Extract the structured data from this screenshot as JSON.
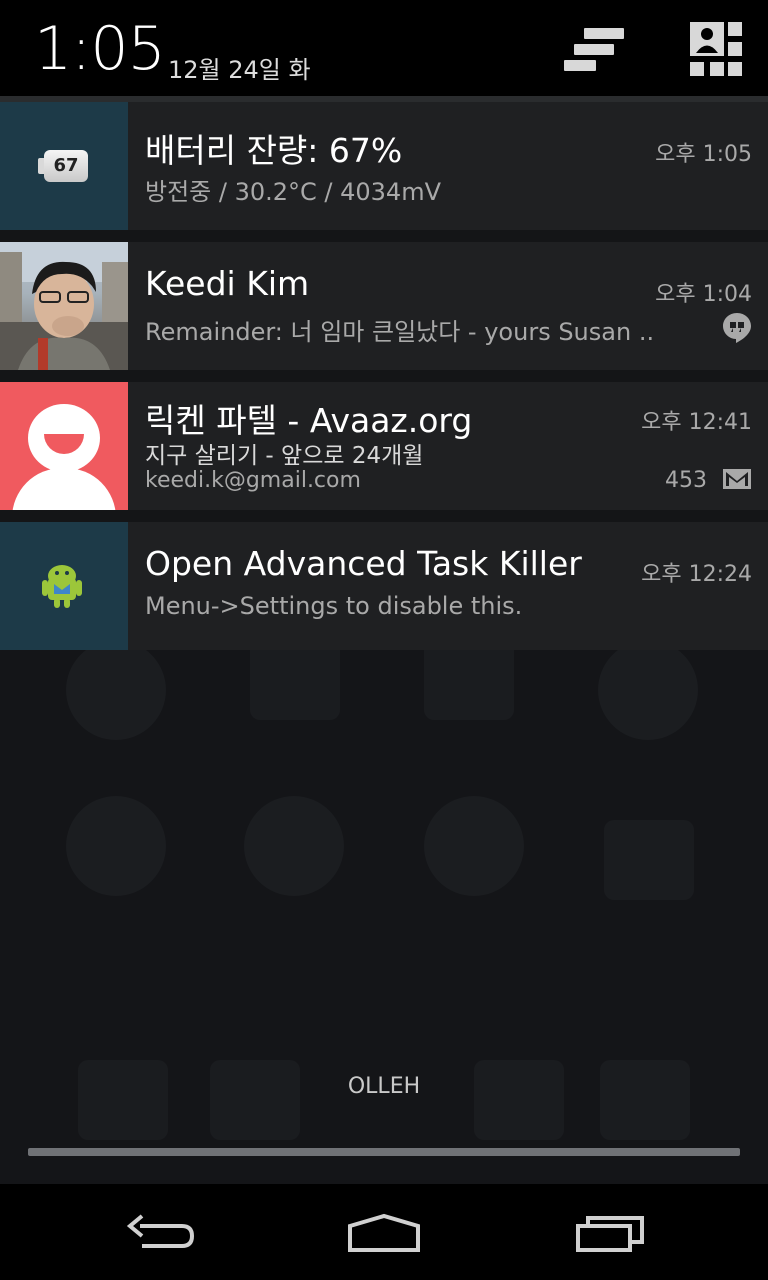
{
  "status": {
    "time": "1:05",
    "date": "12월 24일 화"
  },
  "notifications": [
    {
      "title": "배터리 잔량: 67%",
      "text": "방전중 / 30.2°C / 4034mV",
      "time": "오후 1:05",
      "icon": "battery-icon",
      "badge": "67"
    },
    {
      "title": "Keedi Kim",
      "text": "Remainder: 너 임마 큰일났다 - yours Susan ..",
      "time": "오후 1:04",
      "icon": "hangouts-icon"
    },
    {
      "title": "릭켄 파텔 - Avaaz.org",
      "text": "지구 살리기 - 앞으로 24개월",
      "account": "keedi.k@gmail.com",
      "count": "453",
      "time": "오후 12:41",
      "icon": "gmail-icon"
    },
    {
      "title": "Open Advanced Task Killer",
      "text": "Menu->Settings to disable this.",
      "time": "오후 12:24",
      "icon": "android-icon"
    }
  ],
  "carrier": "OLLEH",
  "colors": {
    "header_bg": "#000000",
    "card_bg": "#1f2022",
    "avatar_bg": "#f05a5f",
    "icon_tile_bg": "#1d3a48"
  }
}
